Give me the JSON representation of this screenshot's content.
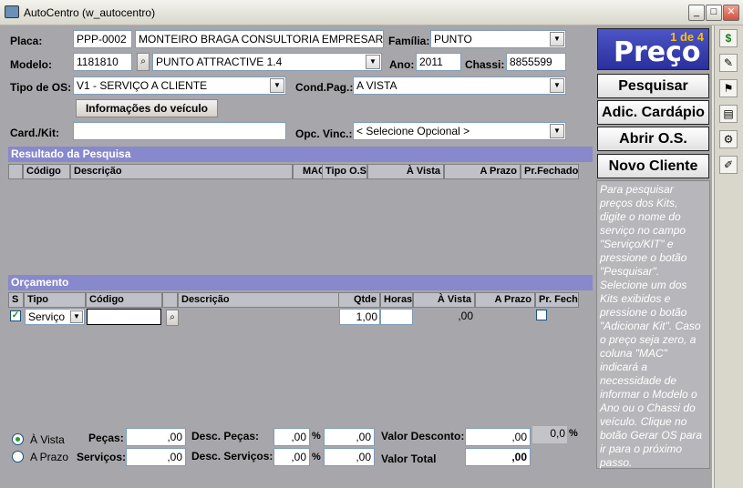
{
  "window": {
    "title": "AutoCentro (w_autocentro)"
  },
  "form": {
    "placa_label": "Placa:",
    "placa_value": "PPP-0002",
    "customer_name": "MONTEIRO BRAGA CONSULTORIA EMPRESARIA",
    "familia_label": "Família:",
    "familia_value": "PUNTO",
    "modelo_label": "Modelo:",
    "modelo_code": "1181810",
    "modelo_desc": "PUNTO ATTRACTIVE 1.4",
    "ano_label": "Ano:",
    "ano_value": "2011",
    "chassi_label": "Chassi:",
    "chassi_value": "8855599",
    "tipo_os_label": "Tipo de OS:",
    "tipo_os_value": "V1 - SERVIÇO A CLIENTE",
    "cond_pag_label": "Cond.Pag.:",
    "cond_pag_value": "A VISTA",
    "info_veiculo_button": "Informações do veículo",
    "card_kit_label": "Card./Kit:",
    "card_kit_value": "",
    "opc_vinc_label": "Opc. Vinc.:",
    "opc_vinc_value": "< Selecione Opcional >"
  },
  "resultado": {
    "title": "Resultado da Pesquisa",
    "columns": [
      "Código",
      "Descrição",
      "MAC",
      "Tipo O.S",
      "À Vista",
      "A Prazo",
      "Pr.Fechado"
    ]
  },
  "orcamento": {
    "title": "Orçamento",
    "columns": [
      "S",
      "Tipo",
      "Código",
      "Descrição",
      "Qtde",
      "Horas",
      "À Vista",
      "A Prazo",
      "Pr. Fech"
    ],
    "row": {
      "tipo": "Serviço",
      "codigo": "",
      "descricao": "",
      "qtde": "1,00",
      "horas": "",
      "a_vista": ",00",
      "a_prazo": ""
    }
  },
  "totals": {
    "a_vista_label": "À Vista",
    "a_prazo_label": "A Prazo",
    "payment_selected": "À Vista",
    "pecas_label": "Peças:",
    "pecas_value": ",00",
    "servicos_label": "Serviços:",
    "servicos_value": ",00",
    "desc_pecas_label": "Desc. Peças:",
    "desc_pecas_pct": ",00",
    "desc_pecas_value": ",00",
    "desc_servicos_label": "Desc. Serviços:",
    "desc_servicos_pct": ",00",
    "desc_servicos_value": ",00",
    "pct_symbol": "%",
    "valor_desconto_label": "Valor Desconto:",
    "valor_desconto_value": ",00",
    "valor_desconto_pct": "0,0",
    "valor_total_label": "Valor Total",
    "valor_total_value": ",00"
  },
  "sidebar": {
    "page_indicator": "1 de 4",
    "title": "Preço",
    "buttons": {
      "pesquisar": "Pesquisar",
      "adic_cardapio": "Adic. Cardápio",
      "abrir_os": "Abrir O.S.",
      "novo_cliente": "Novo Cliente"
    },
    "help_text": "Para pesquisar preços dos Kits, digite o nome do serviço no campo \"Serviço/KIT\" e pressione o botão \"Pesquisar\". Selecione um dos Kits exibidos e pressione o botão \"Adicionar Kit\". Caso o preço seja zero, a coluna \"MAC\" indicará a necessidade de informar o Modelo o Ano ou o Chassi do veículo. Clique no botão Gerar OS para ir para o próximo passo."
  },
  "toolbar_icons": [
    "dollar-icon",
    "edit-icon",
    "flag-icon",
    "print-icon",
    "gear-icon",
    "tools-icon"
  ]
}
